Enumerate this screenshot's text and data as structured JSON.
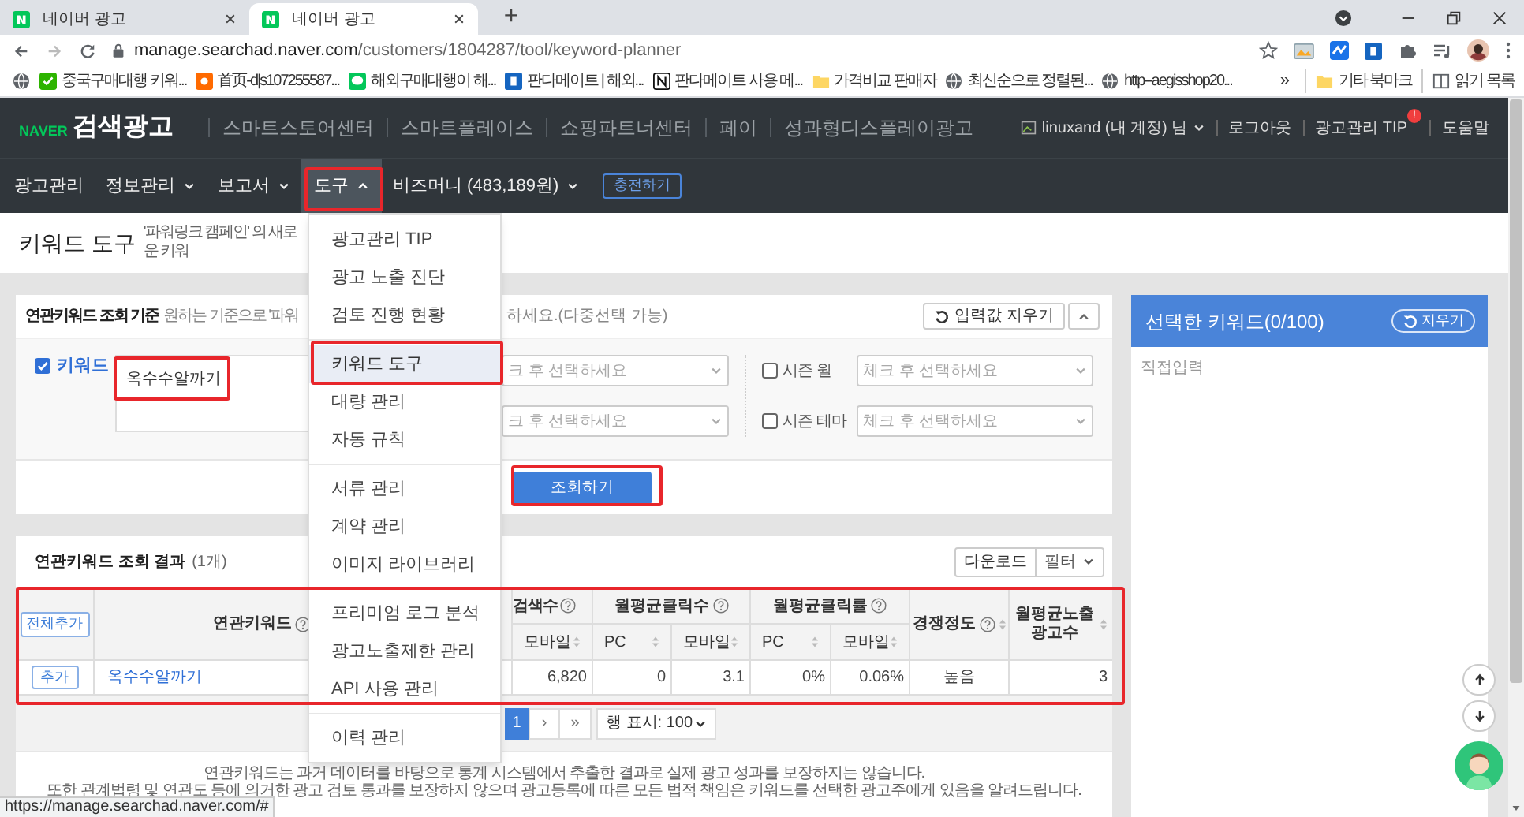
{
  "browser": {
    "tabs": [
      {
        "title": "네이버 광고",
        "selected": false
      },
      {
        "title": "네이버 광고",
        "selected": true
      }
    ],
    "new_tab": "+",
    "url_domain": "manage.searchad.naver.com",
    "url_path": "/customers/1804287/tool/keyword-planner",
    "bookmarks": [
      {
        "kind": "globe"
      },
      {
        "kind": "green",
        "label": "중국구매대행 키워..."
      },
      {
        "kind": "orange",
        "label": "首页-d|s107255587..."
      },
      {
        "kind": "chat",
        "label": "해외구매대행이 해..."
      },
      {
        "kind": "blue",
        "label": "판다메이트 | 해외..."
      },
      {
        "kind": "notion",
        "label": "판다메이트 사용 메..."
      },
      {
        "kind": "folder",
        "label": "가격비교 판매자"
      },
      {
        "kind": "globe",
        "label": "최신순으로 정렬된..."
      },
      {
        "kind": "globe",
        "label": "http--aegisshop20..."
      }
    ],
    "bookmarks_more": "»",
    "other_bookmarks": "기타 북마크",
    "reading_list": "읽기 목록"
  },
  "header": {
    "brand": "NAVER",
    "product": "검색광고",
    "links": [
      "스마트스토어센터",
      "스마트플레이스",
      "쇼핑파트너센터",
      "페이",
      "성과형디스플레이광고"
    ],
    "account": "linuxand (내 계정) 님",
    "logout": "로그아웃",
    "tip": "광고관리 TIP",
    "tip_badge": "!",
    "help": "도움말"
  },
  "nav": {
    "items": [
      {
        "label": "광고관리",
        "kind": "link",
        "selected": false
      },
      {
        "label": "정보관리",
        "kind": "dropdown",
        "selected": false
      },
      {
        "label": "보고서",
        "kind": "dropdown",
        "selected": false
      },
      {
        "label": "도구",
        "kind": "open",
        "selected": true
      },
      {
        "label": "비즈머니 (483,189원)",
        "kind": "dropdown",
        "selected": false
      }
    ],
    "charge_button": "충전하기"
  },
  "page": {
    "title": "키워드 도구",
    "subtitle": "'파워링크 캠페인' 의 새로운 키워"
  },
  "criteria": {
    "title": "연관키워드 조회 기준",
    "hint_left": "원하는 기준으로 '파워",
    "hint_right": "하세요.(다중선택 가능)",
    "clear_button": "입력값 지우기",
    "keyword": {
      "label": "키워드",
      "checked": true,
      "value": "옥수수알까기"
    },
    "selects": [
      {
        "placeholder": "크 후 선택하세요"
      },
      {
        "placeholder": "크 후 선택하세요"
      }
    ],
    "seasons": [
      {
        "label": "시즌 월",
        "checked": false,
        "placeholder": "체크 후 선택하세요"
      },
      {
        "label": "시즌 테마",
        "checked": false,
        "placeholder": "체크 후 선택하세요"
      }
    ],
    "search_button": "조회하기"
  },
  "results": {
    "title": "연관키워드 조회 결과",
    "count": "(1개)",
    "download": "다운로드",
    "filter": "필터",
    "add_all": "전체추가",
    "keyword_header": "연관키워드",
    "groups": [
      "검색수",
      "월평균클릭수",
      "월평균클릭률"
    ],
    "competition_header": "경쟁정도",
    "impressions_header": "월평균노출 광고수",
    "subheaders": [
      "모바일",
      "PC",
      "모바일",
      "PC",
      "모바일"
    ],
    "rows": [
      {
        "add": "추가",
        "keyword": "옥수수알까기",
        "cells": [
          "6,820",
          "0",
          "3.1",
          "0%",
          "0.06%",
          "높음",
          "3"
        ]
      }
    ],
    "pages": [
      {
        "label": "1",
        "selected": true
      }
    ],
    "next": "›",
    "last": "»",
    "page_size": "행 표시: 100",
    "notes": [
      "연관키워드는 과거 데이터를 바탕으로 통계 시스템에서 추출한 결과로 실제 광고 성과를 보장하지는 않습니다.",
      "또한 관계법령 및 연관도 등에 의거한 광고 검토 통과를 보장하지 않으며 광고등록에 따른 모든 법적 책임은 키워드를 선택한 광고주에게 있음을 알려드립니다."
    ]
  },
  "selected_panel": {
    "title": "선택한 키워드(0/100)",
    "clear": "지우기",
    "placeholder": "직접입력"
  },
  "tool_menu": {
    "groups": [
      {
        "items": [
          {
            "label": "광고관리 TIP",
            "selected": false
          },
          {
            "label": "광고 노출 진단",
            "selected": false
          },
          {
            "label": "검토 진행 현황",
            "selected": false
          }
        ]
      },
      {
        "items": [
          {
            "label": "키워드 도구",
            "selected": true
          },
          {
            "label": "대량 관리",
            "selected": false
          },
          {
            "label": "자동 규칙",
            "selected": false
          }
        ]
      },
      {
        "items": [
          {
            "label": "서류 관리",
            "selected": false
          },
          {
            "label": "계약 관리",
            "selected": false
          },
          {
            "label": "이미지 라이브러리",
            "selected": false
          }
        ]
      },
      {
        "items": [
          {
            "label": "프리미엄 로그 분석",
            "selected": false
          },
          {
            "label": "광고노출제한 관리",
            "selected": false
          },
          {
            "label": "API 사용 관리",
            "selected": false
          }
        ]
      },
      {
        "items": [
          {
            "label": "이력 관리",
            "selected": false
          }
        ]
      }
    ]
  },
  "status_url": "https://manage.searchad.naver.com/#"
}
